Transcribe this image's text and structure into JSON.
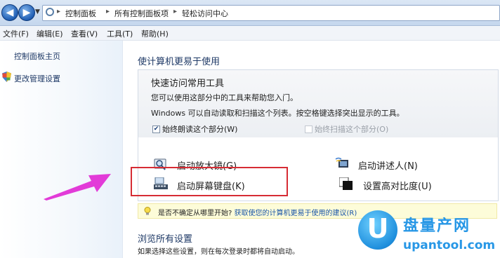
{
  "address": {
    "crumbs": [
      "控制面板",
      "所有控制面板项",
      "轻松访问中心"
    ],
    "separator": "▸"
  },
  "menu": {
    "items": [
      "文件(F)",
      "编辑(E)",
      "查看(V)",
      "工具(T)",
      "帮助(H)"
    ]
  },
  "sidebar": {
    "home": "控制面板主页",
    "admin": "更改管理设置"
  },
  "main": {
    "title": "使计算机更易于使用",
    "tools": {
      "title": "快速访问常用工具",
      "desc1": "您可以使用这部分中的工具来帮助您入门。",
      "desc2": "Windows 可以自动读取和扫描这个列表。按空格键选择突出显示的工具。",
      "read_label": "始终朗读这个部分(W)",
      "read_checked": true,
      "scan_label": "始终扫描这个部分(O)",
      "scan_checked": false,
      "magnifier": "启动放大镜(G)",
      "narrator": "启动讲述人(N)",
      "keyboard": "启动屏幕键盘(K)",
      "contrast": "设置高对比度(U)"
    },
    "tip": {
      "text": "是否不确定从哪里开始?",
      "link": "获取使您的计算机更易于使用的建议(R)"
    },
    "browse": {
      "title": "浏览所有设置",
      "desc": "如果选择这些设置，则在每次登录时都将自动启动。"
    }
  },
  "watermark": {
    "letter": "U",
    "brand": "盘量产网",
    "domain": "upantool.com"
  },
  "colors": {
    "highlight": "#d62c34",
    "arrow": "#e23bd8",
    "link": "#1a55a8"
  }
}
